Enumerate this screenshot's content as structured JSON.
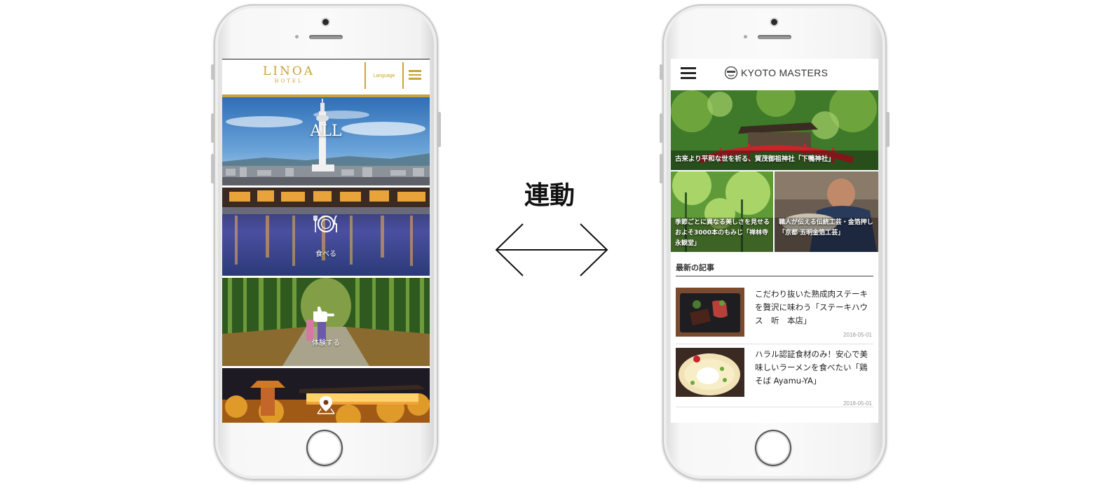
{
  "center": {
    "label": "連動"
  },
  "left_app": {
    "logo": "LINOA",
    "logo_sub": "HOTEL",
    "language_label": "Language",
    "menu_icon": "hamburger-icon",
    "tiles": [
      {
        "label": "ALL",
        "icon": ""
      },
      {
        "label": "食べる",
        "icon": "plate-fork-knife-icon"
      },
      {
        "label": "体験する",
        "icon": "pointing-hand-icon"
      },
      {
        "label": "",
        "icon": "map-pin-icon"
      }
    ]
  },
  "right_app": {
    "logo_text": "KYOTO MASTERS",
    "menu_icon": "hamburger-icon",
    "hero_caption": "古来より平和な世を祈る、賀茂御祖神社「下鴨神社」",
    "features": [
      {
        "caption": "季節ごとに異なる美しさを見せるおよそ3000本のもみじ「禅林寺 永観堂」"
      },
      {
        "caption": "職人が伝える伝統工芸・金箔押し「京都 五明金箔工芸」"
      }
    ],
    "section_title": "最新の記事",
    "articles": [
      {
        "title": "こだわり抜いた熟成肉ステーキを贅沢に味わう「ステーキハウス　听　本店」",
        "date": "2018-05-01"
      },
      {
        "title": "ハラル認証食材のみ！安心で美味しいラーメンを食べたい「鶏そば Ayamu-YA」",
        "date": "2018-05-01"
      }
    ]
  },
  "colors": {
    "gold": "#c9a23a",
    "dark": "#222222"
  }
}
